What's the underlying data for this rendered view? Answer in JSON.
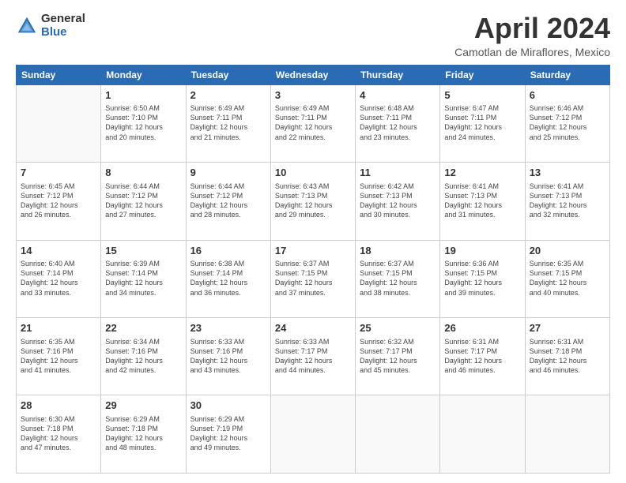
{
  "header": {
    "logo_line1": "General",
    "logo_line2": "Blue",
    "month": "April 2024",
    "location": "Camotlan de Miraflores, Mexico"
  },
  "days_of_week": [
    "Sunday",
    "Monday",
    "Tuesday",
    "Wednesday",
    "Thursday",
    "Friday",
    "Saturday"
  ],
  "weeks": [
    [
      {
        "day": "",
        "empty": true
      },
      {
        "day": "1",
        "sunrise": "6:50 AM",
        "sunset": "7:10 PM",
        "daylight": "12 hours and 20 minutes."
      },
      {
        "day": "2",
        "sunrise": "6:49 AM",
        "sunset": "7:11 PM",
        "daylight": "12 hours and 21 minutes."
      },
      {
        "day": "3",
        "sunrise": "6:49 AM",
        "sunset": "7:11 PM",
        "daylight": "12 hours and 22 minutes."
      },
      {
        "day": "4",
        "sunrise": "6:48 AM",
        "sunset": "7:11 PM",
        "daylight": "12 hours and 23 minutes."
      },
      {
        "day": "5",
        "sunrise": "6:47 AM",
        "sunset": "7:11 PM",
        "daylight": "12 hours and 24 minutes."
      },
      {
        "day": "6",
        "sunrise": "6:46 AM",
        "sunset": "7:12 PM",
        "daylight": "12 hours and 25 minutes."
      }
    ],
    [
      {
        "day": "7",
        "sunrise": "6:45 AM",
        "sunset": "7:12 PM",
        "daylight": "12 hours and 26 minutes."
      },
      {
        "day": "8",
        "sunrise": "6:44 AM",
        "sunset": "7:12 PM",
        "daylight": "12 hours and 27 minutes."
      },
      {
        "day": "9",
        "sunrise": "6:44 AM",
        "sunset": "7:12 PM",
        "daylight": "12 hours and 28 minutes."
      },
      {
        "day": "10",
        "sunrise": "6:43 AM",
        "sunset": "7:13 PM",
        "daylight": "12 hours and 29 minutes."
      },
      {
        "day": "11",
        "sunrise": "6:42 AM",
        "sunset": "7:13 PM",
        "daylight": "12 hours and 30 minutes."
      },
      {
        "day": "12",
        "sunrise": "6:41 AM",
        "sunset": "7:13 PM",
        "daylight": "12 hours and 31 minutes."
      },
      {
        "day": "13",
        "sunrise": "6:41 AM",
        "sunset": "7:13 PM",
        "daylight": "12 hours and 32 minutes."
      }
    ],
    [
      {
        "day": "14",
        "sunrise": "6:40 AM",
        "sunset": "7:14 PM",
        "daylight": "12 hours and 33 minutes."
      },
      {
        "day": "15",
        "sunrise": "6:39 AM",
        "sunset": "7:14 PM",
        "daylight": "12 hours and 34 minutes."
      },
      {
        "day": "16",
        "sunrise": "6:38 AM",
        "sunset": "7:14 PM",
        "daylight": "12 hours and 36 minutes."
      },
      {
        "day": "17",
        "sunrise": "6:37 AM",
        "sunset": "7:15 PM",
        "daylight": "12 hours and 37 minutes."
      },
      {
        "day": "18",
        "sunrise": "6:37 AM",
        "sunset": "7:15 PM",
        "daylight": "12 hours and 38 minutes."
      },
      {
        "day": "19",
        "sunrise": "6:36 AM",
        "sunset": "7:15 PM",
        "daylight": "12 hours and 39 minutes."
      },
      {
        "day": "20",
        "sunrise": "6:35 AM",
        "sunset": "7:15 PM",
        "daylight": "12 hours and 40 minutes."
      }
    ],
    [
      {
        "day": "21",
        "sunrise": "6:35 AM",
        "sunset": "7:16 PM",
        "daylight": "12 hours and 41 minutes."
      },
      {
        "day": "22",
        "sunrise": "6:34 AM",
        "sunset": "7:16 PM",
        "daylight": "12 hours and 42 minutes."
      },
      {
        "day": "23",
        "sunrise": "6:33 AM",
        "sunset": "7:16 PM",
        "daylight": "12 hours and 43 minutes."
      },
      {
        "day": "24",
        "sunrise": "6:33 AM",
        "sunset": "7:17 PM",
        "daylight": "12 hours and 44 minutes."
      },
      {
        "day": "25",
        "sunrise": "6:32 AM",
        "sunset": "7:17 PM",
        "daylight": "12 hours and 45 minutes."
      },
      {
        "day": "26",
        "sunrise": "6:31 AM",
        "sunset": "7:17 PM",
        "daylight": "12 hours and 46 minutes."
      },
      {
        "day": "27",
        "sunrise": "6:31 AM",
        "sunset": "7:18 PM",
        "daylight": "12 hours and 46 minutes."
      }
    ],
    [
      {
        "day": "28",
        "sunrise": "6:30 AM",
        "sunset": "7:18 PM",
        "daylight": "12 hours and 47 minutes."
      },
      {
        "day": "29",
        "sunrise": "6:29 AM",
        "sunset": "7:18 PM",
        "daylight": "12 hours and 48 minutes."
      },
      {
        "day": "30",
        "sunrise": "6:29 AM",
        "sunset": "7:19 PM",
        "daylight": "12 hours and 49 minutes."
      },
      {
        "day": "",
        "empty": true
      },
      {
        "day": "",
        "empty": true
      },
      {
        "day": "",
        "empty": true
      },
      {
        "day": "",
        "empty": true
      }
    ]
  ],
  "labels": {
    "sunrise": "Sunrise:",
    "sunset": "Sunset:",
    "daylight": "Daylight:"
  }
}
